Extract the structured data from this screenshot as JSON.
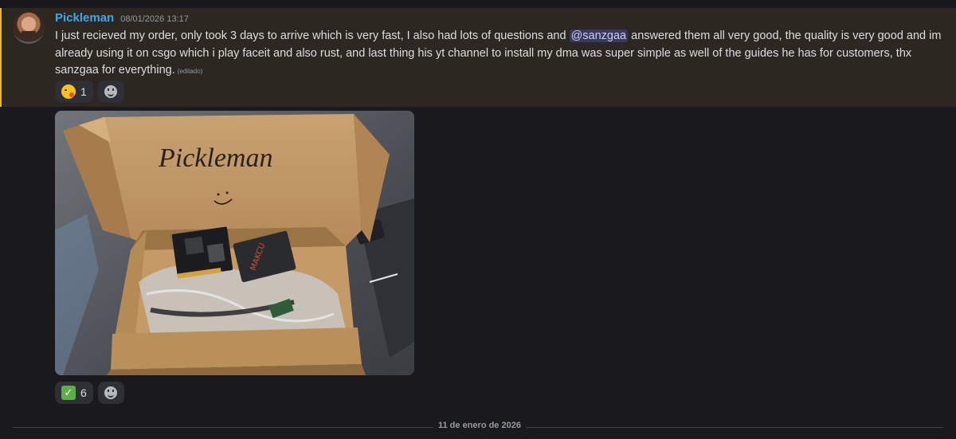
{
  "message": {
    "username": "Pickleman",
    "timestamp": "08/01/2026 13:17",
    "text_part1": "I just recieved my order, only took 3 days to arrive which is very fast, I also had lots of questions and ",
    "mention": "@sanzgaa",
    "text_part2": " answered them all very good, the quality is very good and im already using it on csgo which i play faceit and also rust, and last thing his yt channel to install my dma was super simple as well of the guides he has for customers, thx sanzgaa for everything.",
    "edited_label": "(editado)"
  },
  "reactions_message": [
    {
      "emoji": "yum-face",
      "count": "1"
    }
  ],
  "attachment": {
    "box_handwriting": "Pickleman",
    "smiley": ":)",
    "device_label": "MAKCU"
  },
  "reactions_attachment": [
    {
      "emoji": "white-check-mark",
      "count": "6"
    }
  ],
  "date_divider": "11 de enero de 2026",
  "colors": {
    "highlight_bg": "#2c2720",
    "highlight_border": "#f0b232",
    "username": "#3ba7ec",
    "mention_bg": "#5865f24d"
  }
}
